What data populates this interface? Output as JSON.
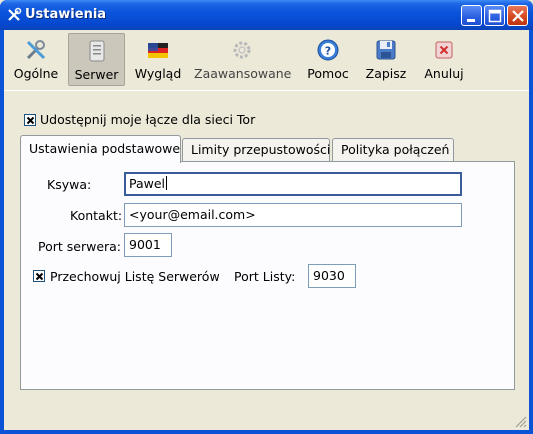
{
  "window": {
    "title": "Ustawienia"
  },
  "toolbar": {
    "items": [
      {
        "label": "Ogólne",
        "icon": "tools-icon"
      },
      {
        "label": "Serwer",
        "icon": "server-icon",
        "active": true
      },
      {
        "label": "Wygląd",
        "icon": "appearance-flag-icon"
      },
      {
        "label": "Zaawansowane",
        "icon": "gear-icon",
        "disabled": true
      },
      {
        "label": "Pomoc",
        "icon": "help-icon"
      },
      {
        "label": "Zapisz",
        "icon": "save-icon"
      },
      {
        "label": "Anuluj",
        "icon": "cancel-icon"
      }
    ]
  },
  "relay": {
    "share_label": "Udostępnij moje łącze dla sieci Tor",
    "share_checked": true
  },
  "tabs": [
    {
      "label": "Ustawienia podstawowe",
      "active": true
    },
    {
      "label": "Limity przepustowości"
    },
    {
      "label": "Polityka połączeń"
    }
  ],
  "form": {
    "nickname_label": "Ksywa:",
    "nickname_value": "Pawel",
    "contact_label": "Kontakt:",
    "contact_value": "<your@email.com>",
    "port_label": "Port serwera:",
    "port_value": "9001",
    "dir_label": "Przechowuj Listę Serwerów",
    "dir_checked": true,
    "dir_port_label": "Port Listy:",
    "dir_port_value": "9030"
  },
  "colors": {
    "titlebar": "#0a55dc",
    "panel_bg": "#fcfcfe",
    "window_bg": "#ece9d8",
    "focus_border": "#3c5b9a"
  }
}
